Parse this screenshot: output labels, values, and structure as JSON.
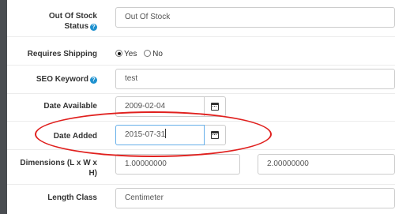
{
  "form": {
    "stock_status": {
      "label_line1": "Out Of Stock",
      "label_line2": "Status",
      "value": "Out Of Stock"
    },
    "requires_shipping": {
      "label": "Requires Shipping",
      "option_yes": "Yes",
      "option_no": "No",
      "selected": "yes"
    },
    "seo_keyword": {
      "label": "SEO Keyword",
      "value": "test"
    },
    "date_available": {
      "label": "Date Available",
      "value": "2009-02-04"
    },
    "date_added": {
      "label": "Date Added",
      "value": "2015-07-31"
    },
    "dimensions": {
      "label_line1": "Dimensions (L x W x",
      "label_line2": "H)",
      "length": "1.00000000",
      "width": "2.00000000"
    },
    "length_class": {
      "label": "Length Class",
      "value": "Centimeter"
    }
  },
  "icons": {
    "help": "question-circle-icon",
    "calendar": "calendar-icon"
  },
  "help_glyph": "?",
  "annotation_color": "#e0201e"
}
